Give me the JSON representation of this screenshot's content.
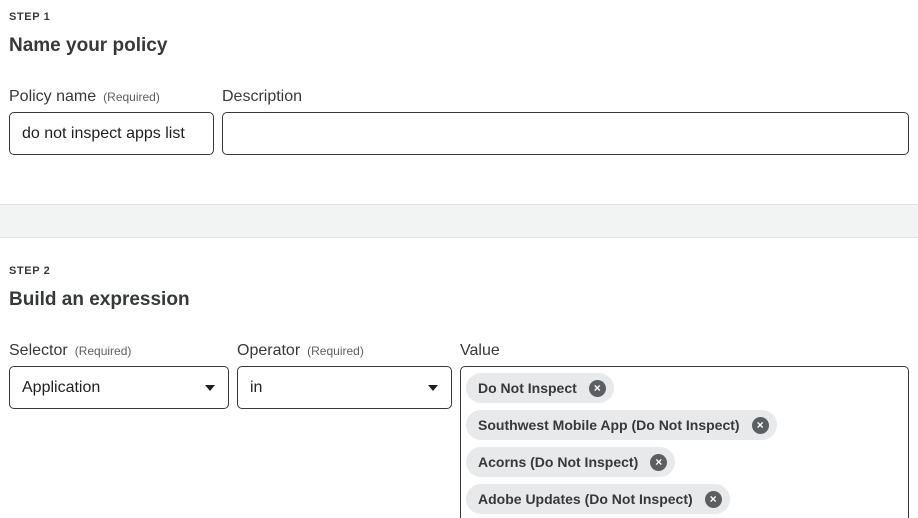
{
  "step1": {
    "label": "STEP 1",
    "title": "Name your policy",
    "policy_name": {
      "label": "Policy name",
      "required": "(Required)",
      "value": "do not inspect apps list"
    },
    "description": {
      "label": "Description",
      "value": ""
    }
  },
  "step2": {
    "label": "STEP 2",
    "title": "Build an expression",
    "selector": {
      "label": "Selector",
      "required": "(Required)",
      "value": "Application"
    },
    "operator": {
      "label": "Operator",
      "required": "(Required)",
      "value": "in"
    },
    "value": {
      "label": "Value",
      "chips": [
        {
          "text": "Do Not Inspect",
          "remove": "×"
        },
        {
          "text": "Southwest Mobile App (Do Not Inspect)",
          "remove": "×"
        },
        {
          "text": "Acorns (Do Not Inspect)",
          "remove": "×"
        },
        {
          "text": "Adobe Updates (Do Not Inspect)",
          "remove": "×"
        }
      ]
    }
  },
  "icons": {
    "dropdown": "chevron-down-icon",
    "chip_remove": "close-icon"
  }
}
